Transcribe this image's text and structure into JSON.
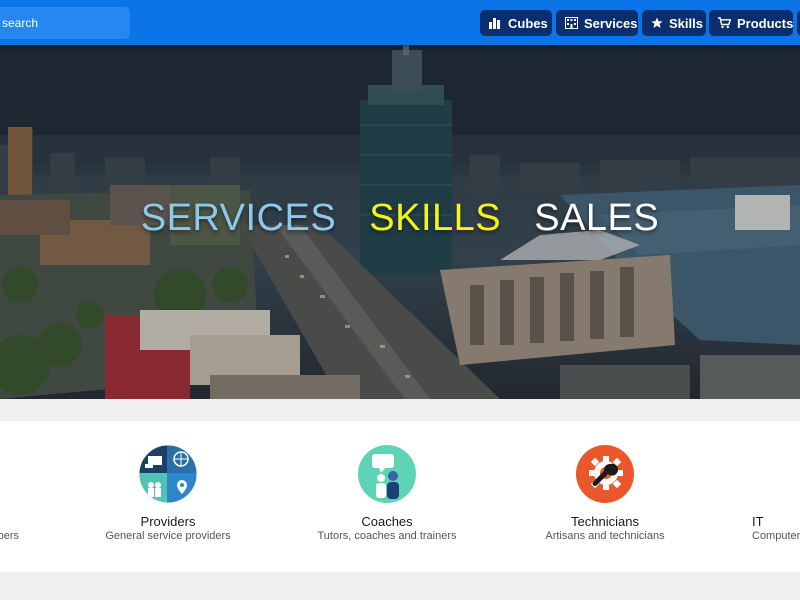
{
  "search": {
    "placeholder": "search"
  },
  "nav": {
    "cubes": "Cubes",
    "services": "Services",
    "skills": "Skills",
    "products": "Products"
  },
  "hero": {
    "words": [
      {
        "text": "SERVICES",
        "color": "#8ec9ec"
      },
      {
        "text": "SKILLS",
        "color": "#f4f41a"
      },
      {
        "text": "SALES",
        "color": "#ffffff"
      }
    ]
  },
  "categories": {
    "left_partial": {
      "subtitle": "bers"
    },
    "providers": {
      "title": "Providers",
      "subtitle": "General service providers",
      "icon": "providers-collage-icon"
    },
    "coaches": {
      "title": "Coaches",
      "subtitle": "Tutors, coaches and trainers",
      "icon": "coach-person-icon"
    },
    "technicians": {
      "title": "Technicians",
      "subtitle": "Artisans and technicians",
      "icon": "wrench-gear-icon"
    },
    "it": {
      "title": "IT",
      "subtitle": "Computer"
    }
  },
  "colors": {
    "topbar": "#0b74e8",
    "nav_button": "#0b2e6e",
    "coaches_icon_bg": "#5fd3b6",
    "technicians_icon_bg": "#e9572a",
    "providers_icon_bg": "#1b4f7a"
  }
}
